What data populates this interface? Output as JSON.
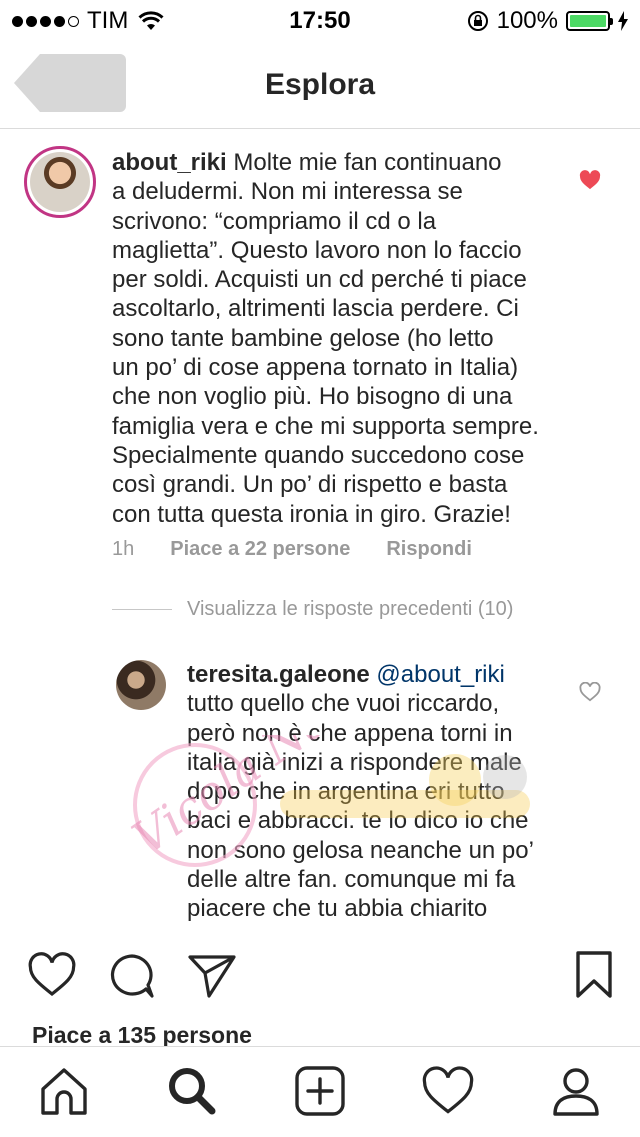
{
  "status_bar": {
    "carrier": "TIM",
    "time": "17:50",
    "battery": "100%",
    "battery_level": 1.0
  },
  "nav": {
    "title": "Esplora"
  },
  "comment": {
    "username": "about_riki",
    "text": " Molte mie fan continuano\na deludermi. Non mi interessa se\nscrivono: “compriamo il cd o la\nmaglietta”. Questo lavoro non lo faccio\nper soldi. Acquisti un cd perché ti piace\nascoltarlo, altrimenti lascia perdere. Ci\nsono tante bambine gelose (ho letto\nun po’ di cose appena tornato in Italia)\nche non voglio più. Ho bisogno di una\nfamiglia vera e che mi supporta sempre.\nSpecialmente quando succedono cose\ncosì grandi. Un po’ di rispetto e basta\ncon tutta questa ironia in giro. Grazie!",
    "time": "1h",
    "likes": "Piace a 22 persone",
    "reply": "Rispondi",
    "liked": true,
    "heart_color": "#ed4956"
  },
  "view_replies": "Visualizza le risposte precedenti (10)",
  "reply": {
    "username": "teresita.galeone",
    "mention": "@about_riki",
    "text": "\ntutto quello che vuoi riccardo,\nperò non è che appena torni in\nitalia già inizi a rispondere male\ndopo che in argentina eri tutto\nbaci e abbracci. te lo dico io che\nnon sono gelosa neanche un po’\ndelle altre fan. comunque mi fa\npiacere che tu abbia chiarito",
    "liked": false
  },
  "watermark": {
    "text": "Vicola Nails"
  },
  "post": {
    "likes": "Piace a 135 persone"
  },
  "icons": {
    "back": "back-button",
    "like": "heart-icon",
    "comment": "comment-bubble-icon",
    "share": "paper-plane-icon",
    "save": "bookmark-icon",
    "tabs": [
      "home-icon",
      "search-icon",
      "add-post-icon",
      "activity-heart-icon",
      "profile-icon"
    ]
  }
}
